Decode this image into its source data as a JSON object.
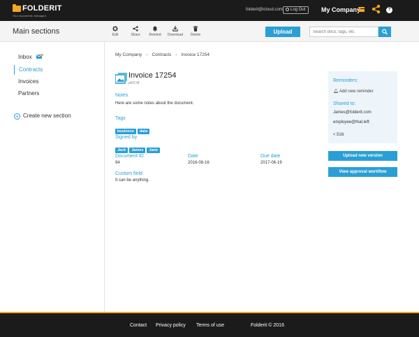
{
  "brand": {
    "name": "FOLDERIT",
    "tagline": "Your documents. Managed."
  },
  "topbar": {
    "email": "folderit@icloud.com",
    "logout_label": "Log Out",
    "company": "My Company"
  },
  "toolbar": {
    "title": "Main sections",
    "actions": [
      {
        "label": "Edit",
        "icon": "gear-icon"
      },
      {
        "label": "Share",
        "icon": "share-icon"
      },
      {
        "label": "Remind",
        "icon": "bell-icon"
      },
      {
        "label": "Download",
        "icon": "download-icon"
      },
      {
        "label": "Delete",
        "icon": "trash-icon"
      }
    ],
    "upload_label": "Upload",
    "search_placeholder": "Search docs, tags, etc"
  },
  "sidebar": {
    "items": [
      {
        "label": "Inbox"
      },
      {
        "label": "Contracts"
      },
      {
        "label": "Invoices"
      },
      {
        "label": "Partners"
      }
    ],
    "create_label": "Create new section"
  },
  "breadcrumb": [
    "My Company",
    "Contracts",
    "Invoice 17254"
  ],
  "document": {
    "title": "Invoice 17254",
    "filename": "pill2.tif",
    "notes_label": "Notes",
    "notes": "Here are some notes about the document.",
    "tags_label": "Tags",
    "tags": [
      "business",
      "data"
    ],
    "signed_label": "Signed by",
    "signed": [
      "Jack",
      "James",
      "Jane"
    ],
    "id_label": "Document ID",
    "id_value": "94",
    "date_label": "Date",
    "date_value": "2016-08-16",
    "due_label": "Due date",
    "due_value": "2017-06-19",
    "custom_label": "Custom field",
    "custom_value": "It can be anything."
  },
  "panel": {
    "reminders_label": "Reminders:",
    "add_reminder": "Add new reminder",
    "shared_label": "Shared to:",
    "shared": [
      "James@folderit.com",
      "employee@that.left"
    ],
    "edit_label": "Edit",
    "upload_version": "Upload new version",
    "approval": "View approval workflow"
  },
  "footer": {
    "contact": "Contact",
    "privacy": "Privacy policy",
    "terms": "Terms of use",
    "copyright": "Folderit © 2016"
  },
  "colors": {
    "accent": "#2a9fd6",
    "brand": "#f5a623",
    "dark": "#1b1b1b"
  }
}
